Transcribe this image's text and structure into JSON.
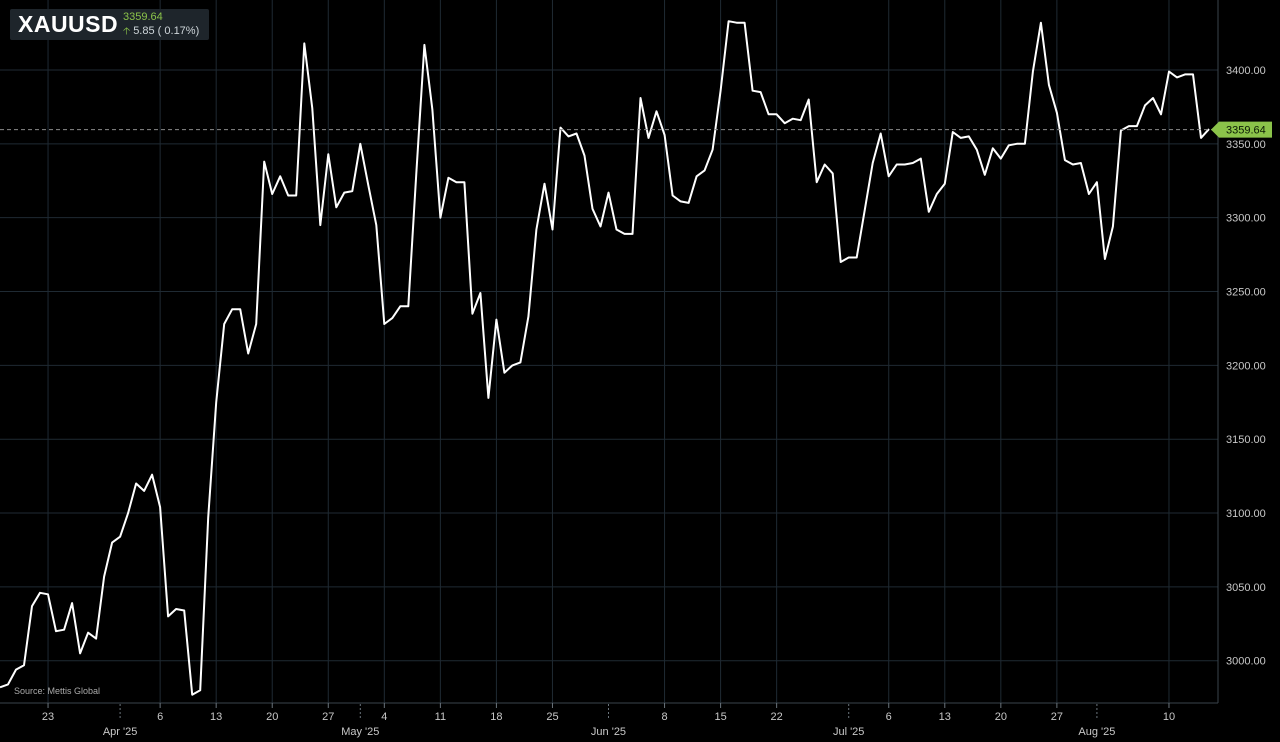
{
  "ticker": {
    "symbol": "XAUUSD",
    "price": "3359.64",
    "change": "5.85",
    "change_pct": "( 0.17%)",
    "arrow": "up-arrow-icon"
  },
  "source": "Source: Mettis Global",
  "colors": {
    "background": "#000000",
    "grid": "#1f2a33",
    "line": "#ffffff",
    "last_price_tag": "#8bc34a",
    "up": "#8bc34a"
  },
  "chart_data": {
    "type": "line",
    "title": "",
    "xlabel": "",
    "ylabel": "",
    "ylim": [
      2968,
      3444
    ],
    "yticks": [
      3000,
      3050,
      3100,
      3150,
      3200,
      3250,
      3300,
      3350,
      3400
    ],
    "ytick_labels": [
      "3000.00",
      "3050.00",
      "3100.00",
      "3150.00",
      "3200.00",
      "3250.00",
      "3300.00",
      "3350.00",
      "3400.00"
    ],
    "last_price": 3359.64,
    "last_price_label": "3359.64",
    "grid": true,
    "xlim": [
      "2025-03-17",
      "2025-08-14"
    ],
    "xticks": [
      {
        "date": "2025-03-23",
        "label": "23",
        "month": ""
      },
      {
        "date": "2025-04-01",
        "label": "",
        "month": "Apr '25"
      },
      {
        "date": "2025-04-06",
        "label": "6",
        "month": ""
      },
      {
        "date": "2025-04-13",
        "label": "13",
        "month": ""
      },
      {
        "date": "2025-04-20",
        "label": "20",
        "month": ""
      },
      {
        "date": "2025-04-27",
        "label": "27",
        "month": ""
      },
      {
        "date": "2025-05-01",
        "label": "",
        "month": "May '25"
      },
      {
        "date": "2025-05-04",
        "label": "4",
        "month": ""
      },
      {
        "date": "2025-05-11",
        "label": "11",
        "month": ""
      },
      {
        "date": "2025-05-18",
        "label": "18",
        "month": ""
      },
      {
        "date": "2025-05-25",
        "label": "25",
        "month": ""
      },
      {
        "date": "2025-06-01",
        "label": "",
        "month": "Jun '25"
      },
      {
        "date": "2025-06-08",
        "label": "8",
        "month": ""
      },
      {
        "date": "2025-06-15",
        "label": "15",
        "month": ""
      },
      {
        "date": "2025-06-22",
        "label": "22",
        "month": ""
      },
      {
        "date": "2025-07-01",
        "label": "",
        "month": "Jul '25"
      },
      {
        "date": "2025-07-06",
        "label": "6",
        "month": ""
      },
      {
        "date": "2025-07-13",
        "label": "13",
        "month": ""
      },
      {
        "date": "2025-07-20",
        "label": "20",
        "month": ""
      },
      {
        "date": "2025-07-27",
        "label": "27",
        "month": ""
      },
      {
        "date": "2025-08-01",
        "label": "",
        "month": "Aug '25"
      },
      {
        "date": "2025-08-10",
        "label": "10",
        "month": ""
      }
    ],
    "series": [
      {
        "values": [
          [
            "2025-03-17",
            2982
          ],
          [
            "2025-03-18",
            2984
          ],
          [
            "2025-03-19",
            2994
          ],
          [
            "2025-03-20",
            2997
          ],
          [
            "2025-03-21",
            3037
          ],
          [
            "2025-03-22",
            3046
          ],
          [
            "2025-03-23",
            3045
          ],
          [
            "2025-03-24",
            3020
          ],
          [
            "2025-03-25",
            3021
          ],
          [
            "2025-03-26",
            3039
          ],
          [
            "2025-03-27",
            3005
          ],
          [
            "2025-03-28",
            3019
          ],
          [
            "2025-03-29",
            3015
          ],
          [
            "2025-03-30",
            3057
          ],
          [
            "2025-03-31",
            3080
          ],
          [
            "2025-04-01",
            3084
          ],
          [
            "2025-04-02",
            3100
          ],
          [
            "2025-04-03",
            3120
          ],
          [
            "2025-04-04",
            3115
          ],
          [
            "2025-04-05",
            3126
          ],
          [
            "2025-04-06",
            3104
          ],
          [
            "2025-04-07",
            3030
          ],
          [
            "2025-04-08",
            3035
          ],
          [
            "2025-04-09",
            3034
          ],
          [
            "2025-04-10",
            2977
          ],
          [
            "2025-04-11",
            2980
          ],
          [
            "2025-04-12",
            3097
          ],
          [
            "2025-04-13",
            3175
          ],
          [
            "2025-04-14",
            3228
          ],
          [
            "2025-04-15",
            3238
          ],
          [
            "2025-04-16",
            3238
          ],
          [
            "2025-04-17",
            3208
          ],
          [
            "2025-04-18",
            3228
          ],
          [
            "2025-04-19",
            3338
          ],
          [
            "2025-04-20",
            3316
          ],
          [
            "2025-04-21",
            3328
          ],
          [
            "2025-04-22",
            3315
          ],
          [
            "2025-04-23",
            3315
          ],
          [
            "2025-04-24",
            3418
          ],
          [
            "2025-04-25",
            3374
          ],
          [
            "2025-04-26",
            3295
          ],
          [
            "2025-04-27",
            3343
          ],
          [
            "2025-04-28",
            3307
          ],
          [
            "2025-04-29",
            3317
          ],
          [
            "2025-04-30",
            3318
          ],
          [
            "2025-05-01",
            3350
          ],
          [
            "2025-05-02",
            3322
          ],
          [
            "2025-05-03",
            3295
          ],
          [
            "2025-05-04",
            3228
          ],
          [
            "2025-05-05",
            3232
          ],
          [
            "2025-05-06",
            3240
          ],
          [
            "2025-05-07",
            3240
          ],
          [
            "2025-05-08",
            3330
          ],
          [
            "2025-05-09",
            3417
          ],
          [
            "2025-05-10",
            3373
          ],
          [
            "2025-05-11",
            3300
          ],
          [
            "2025-05-12",
            3327
          ],
          [
            "2025-05-13",
            3324
          ],
          [
            "2025-05-14",
            3324
          ],
          [
            "2025-05-15",
            3235
          ],
          [
            "2025-05-16",
            3249
          ],
          [
            "2025-05-17",
            3178
          ],
          [
            "2025-05-18",
            3231
          ],
          [
            "2025-05-19",
            3195
          ],
          [
            "2025-05-20",
            3200
          ],
          [
            "2025-05-21",
            3202
          ],
          [
            "2025-05-22",
            3233
          ],
          [
            "2025-05-23",
            3292
          ],
          [
            "2025-05-24",
            3323
          ],
          [
            "2025-05-25",
            3292
          ],
          [
            "2025-05-26",
            3361
          ],
          [
            "2025-05-27",
            3355
          ],
          [
            "2025-05-28",
            3357
          ],
          [
            "2025-05-29",
            3342
          ],
          [
            "2025-05-30",
            3306
          ],
          [
            "2025-05-31",
            3294
          ],
          [
            "2025-06-01",
            3317
          ],
          [
            "2025-06-02",
            3292
          ],
          [
            "2025-06-03",
            3289
          ],
          [
            "2025-06-04",
            3289
          ],
          [
            "2025-06-05",
            3381
          ],
          [
            "2025-06-06",
            3354
          ],
          [
            "2025-06-07",
            3372
          ],
          [
            "2025-06-08",
            3356
          ],
          [
            "2025-06-09",
            3315
          ],
          [
            "2025-06-10",
            3311
          ],
          [
            "2025-06-11",
            3310
          ],
          [
            "2025-06-12",
            3328
          ],
          [
            "2025-06-13",
            3332
          ],
          [
            "2025-06-14",
            3346
          ],
          [
            "2025-06-15",
            3386
          ],
          [
            "2025-06-16",
            3433
          ],
          [
            "2025-06-17",
            3432
          ],
          [
            "2025-06-18",
            3432
          ],
          [
            "2025-06-19",
            3386
          ],
          [
            "2025-06-20",
            3385
          ],
          [
            "2025-06-21",
            3370
          ],
          [
            "2025-06-22",
            3370
          ],
          [
            "2025-06-23",
            3364
          ],
          [
            "2025-06-24",
            3367
          ],
          [
            "2025-06-25",
            3366
          ],
          [
            "2025-06-26",
            3380
          ],
          [
            "2025-06-27",
            3324
          ],
          [
            "2025-06-28",
            3336
          ],
          [
            "2025-06-29",
            3330
          ],
          [
            "2025-06-30",
            3270
          ],
          [
            "2025-07-01",
            3273
          ],
          [
            "2025-07-02",
            3273
          ],
          [
            "2025-07-03",
            3305
          ],
          [
            "2025-07-04",
            3337
          ],
          [
            "2025-07-05",
            3357
          ],
          [
            "2025-07-06",
            3328
          ],
          [
            "2025-07-07",
            3336
          ],
          [
            "2025-07-08",
            3336
          ],
          [
            "2025-07-09",
            3337
          ],
          [
            "2025-07-10",
            3340
          ],
          [
            "2025-07-11",
            3304
          ],
          [
            "2025-07-12",
            3316
          ],
          [
            "2025-07-13",
            3323
          ],
          [
            "2025-07-14",
            3358
          ],
          [
            "2025-07-15",
            3354
          ],
          [
            "2025-07-16",
            3355
          ],
          [
            "2025-07-17",
            3346
          ],
          [
            "2025-07-18",
            3329
          ],
          [
            "2025-07-19",
            3347
          ],
          [
            "2025-07-20",
            3340
          ],
          [
            "2025-07-21",
            3349
          ],
          [
            "2025-07-22",
            3350
          ],
          [
            "2025-07-23",
            3350
          ],
          [
            "2025-07-24",
            3399
          ],
          [
            "2025-07-25",
            3432
          ],
          [
            "2025-07-26",
            3390
          ],
          [
            "2025-07-27",
            3371
          ],
          [
            "2025-07-28",
            3339
          ],
          [
            "2025-07-29",
            3336
          ],
          [
            "2025-07-30",
            3337
          ],
          [
            "2025-07-31",
            3316
          ],
          [
            "2025-08-01",
            3324
          ],
          [
            "2025-08-02",
            3272
          ],
          [
            "2025-08-03",
            3294
          ],
          [
            "2025-08-04",
            3359
          ],
          [
            "2025-08-05",
            3362
          ],
          [
            "2025-08-06",
            3362
          ],
          [
            "2025-08-07",
            3376
          ],
          [
            "2025-08-08",
            3381
          ],
          [
            "2025-08-09",
            3370
          ],
          [
            "2025-08-10",
            3399
          ],
          [
            "2025-08-11",
            3395
          ],
          [
            "2025-08-12",
            3397
          ],
          [
            "2025-08-13",
            3397
          ],
          [
            "2025-08-14",
            3354
          ],
          [
            "2025-08-15",
            3360
          ]
        ]
      }
    ]
  }
}
